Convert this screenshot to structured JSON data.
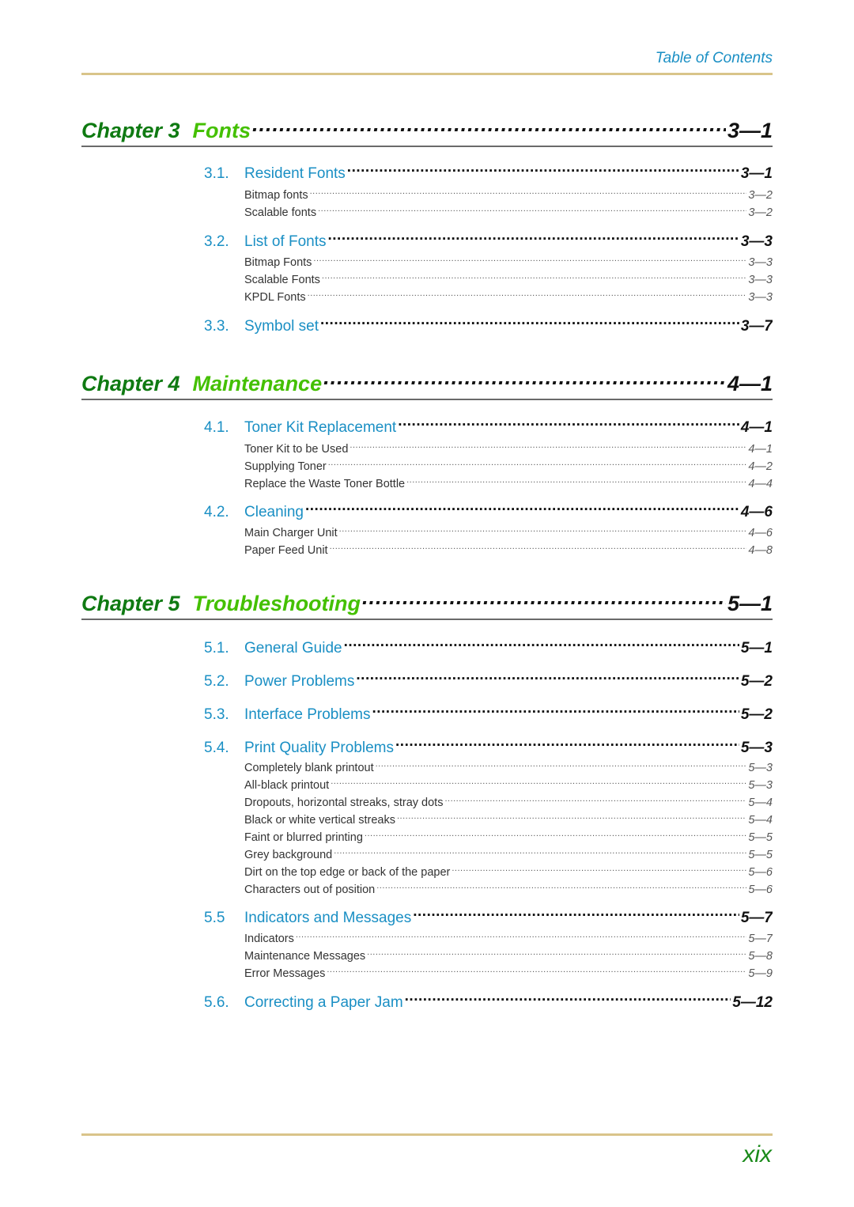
{
  "header": {
    "title": "Table of Contents"
  },
  "footer": {
    "page_number": "xix"
  },
  "colors": {
    "chapter_label": "#0f7a12",
    "chapter_title": "#44c000",
    "section_title": "#1a8fc4",
    "rule": "#d9c48a"
  },
  "chapters": [
    {
      "label": "Chapter 3",
      "title": "Fonts",
      "page": "3—1",
      "sections": [
        {
          "number": "3.1.",
          "title": "Resident Fonts",
          "page": "3—1",
          "items": [
            {
              "title": "Bitmap fonts",
              "page": "3—2"
            },
            {
              "title": "Scalable fonts",
              "page": "3—2"
            }
          ]
        },
        {
          "number": "3.2.",
          "title": "List of Fonts",
          "page": "3—3",
          "items": [
            {
              "title": "Bitmap Fonts",
              "page": "3—3"
            },
            {
              "title": "Scalable Fonts",
              "page": "3—3"
            },
            {
              "title": "KPDL Fonts",
              "page": "3—3"
            }
          ]
        },
        {
          "number": "3.3.",
          "title": "Symbol set",
          "page": "3—7",
          "items": []
        }
      ]
    },
    {
      "label": "Chapter 4",
      "title": "Maintenance",
      "page": "4—1",
      "sections": [
        {
          "number": "4.1.",
          "title": "Toner Kit Replacement",
          "page": "4—1",
          "items": [
            {
              "title": "Toner Kit to be Used",
              "page": "4—1"
            },
            {
              "title": "Supplying Toner",
              "page": "4—2"
            },
            {
              "title": "Replace the Waste Toner Bottle",
              "page": "4—4"
            }
          ]
        },
        {
          "number": "4.2.",
          "title": "Cleaning",
          "page": "4—6",
          "items": [
            {
              "title": "Main Charger Unit",
              "page": "4—6"
            },
            {
              "title": "Paper Feed Unit",
              "page": "4—8"
            }
          ]
        }
      ]
    },
    {
      "label": "Chapter 5",
      "title": "Troubleshooting",
      "page": "5—1",
      "sections": [
        {
          "number": "5.1.",
          "title": "General Guide",
          "page": "5—1",
          "items": []
        },
        {
          "number": "5.2.",
          "title": "Power Problems",
          "page": "5—2",
          "items": []
        },
        {
          "number": "5.3.",
          "title": "Interface Problems",
          "page": "5—2",
          "items": []
        },
        {
          "number": "5.4.",
          "title": "Print Quality Problems",
          "page": "5—3",
          "items": [
            {
              "title": "Completely blank printout",
              "page": "5—3"
            },
            {
              "title": "All-black printout",
              "page": "5—3"
            },
            {
              "title": "Dropouts, horizontal streaks, stray dots",
              "page": "5—4"
            },
            {
              "title": "Black or white vertical streaks",
              "page": "5—4"
            },
            {
              "title": "Faint or blurred printing",
              "page": "5—5"
            },
            {
              "title": "Grey background",
              "page": "5—5"
            },
            {
              "title": "Dirt on the top edge or back of the paper",
              "page": "5—6"
            },
            {
              "title": "Characters out of position",
              "page": "5—6"
            }
          ]
        },
        {
          "number": "5.5",
          "title": "Indicators and Messages",
          "page": "5—7",
          "items": [
            {
              "title": "Indicators",
              "page": "5—7"
            },
            {
              "title": "Maintenance Messages",
              "page": "5—8"
            },
            {
              "title": "Error Messages",
              "page": "5—9"
            }
          ]
        },
        {
          "number": "5.6.",
          "title": "Correcting a Paper Jam",
          "page": "5—12",
          "items": []
        }
      ]
    }
  ]
}
